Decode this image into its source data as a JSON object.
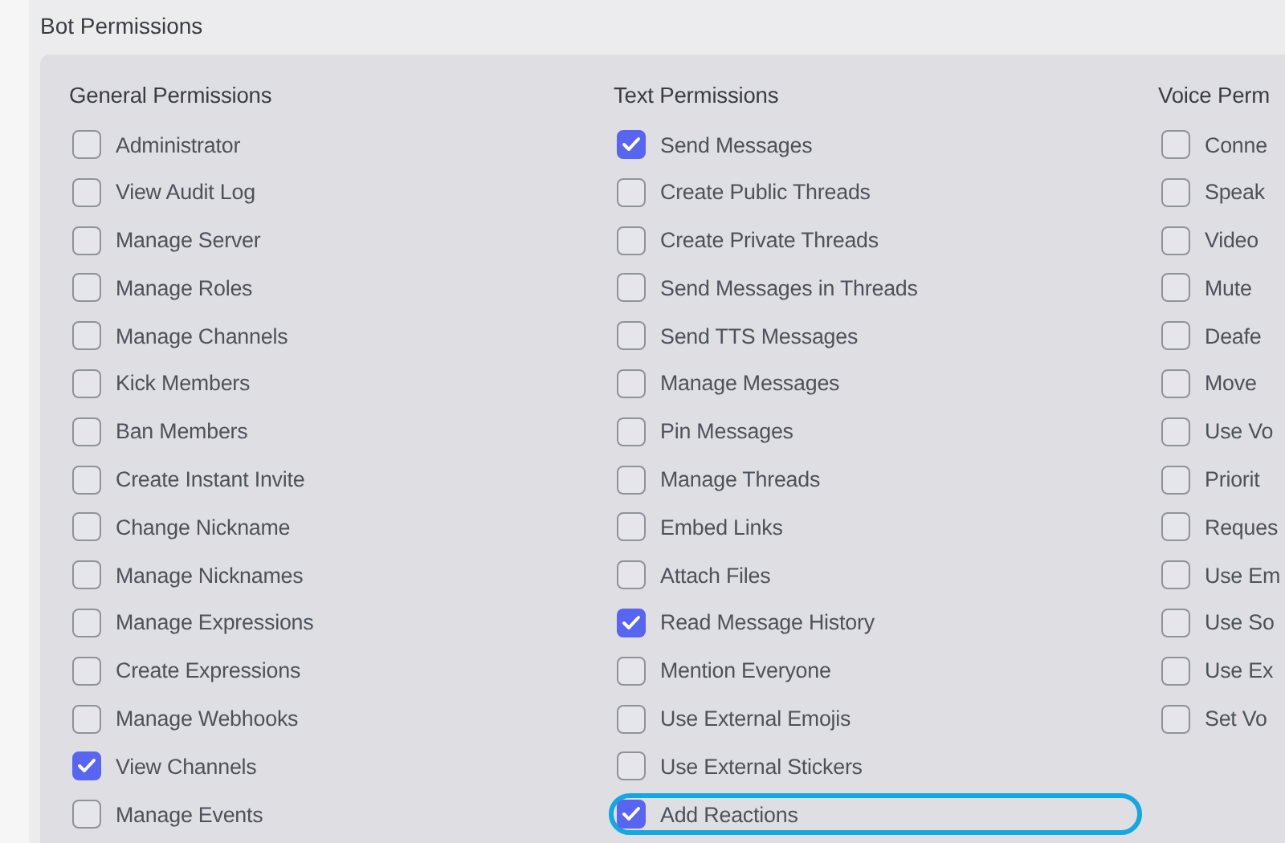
{
  "title": "Bot Permissions",
  "groups": [
    {
      "heading": "General Permissions",
      "items": [
        {
          "label": "Administrator",
          "checked": false,
          "highlighted": false
        },
        {
          "label": "View Audit Log",
          "checked": false,
          "highlighted": false
        },
        {
          "label": "Manage Server",
          "checked": false,
          "highlighted": false
        },
        {
          "label": "Manage Roles",
          "checked": false,
          "highlighted": false
        },
        {
          "label": "Manage Channels",
          "checked": false,
          "highlighted": false
        },
        {
          "label": "Kick Members",
          "checked": false,
          "highlighted": false
        },
        {
          "label": "Ban Members",
          "checked": false,
          "highlighted": false
        },
        {
          "label": "Create Instant Invite",
          "checked": false,
          "highlighted": false
        },
        {
          "label": "Change Nickname",
          "checked": false,
          "highlighted": false
        },
        {
          "label": "Manage Nicknames",
          "checked": false,
          "highlighted": false
        },
        {
          "label": "Manage Expressions",
          "checked": false,
          "highlighted": false
        },
        {
          "label": "Create Expressions",
          "checked": false,
          "highlighted": false
        },
        {
          "label": "Manage Webhooks",
          "checked": false,
          "highlighted": false
        },
        {
          "label": "View Channels",
          "checked": true,
          "highlighted": false
        },
        {
          "label": "Manage Events",
          "checked": false,
          "highlighted": false
        }
      ]
    },
    {
      "heading": "Text Permissions",
      "items": [
        {
          "label": "Send Messages",
          "checked": true,
          "highlighted": false
        },
        {
          "label": "Create Public Threads",
          "checked": false,
          "highlighted": false
        },
        {
          "label": "Create Private Threads",
          "checked": false,
          "highlighted": false
        },
        {
          "label": "Send Messages in Threads",
          "checked": false,
          "highlighted": false
        },
        {
          "label": "Send TTS Messages",
          "checked": false,
          "highlighted": false
        },
        {
          "label": "Manage Messages",
          "checked": false,
          "highlighted": false
        },
        {
          "label": "Pin Messages",
          "checked": false,
          "highlighted": false
        },
        {
          "label": "Manage Threads",
          "checked": false,
          "highlighted": false
        },
        {
          "label": "Embed Links",
          "checked": false,
          "highlighted": false
        },
        {
          "label": "Attach Files",
          "checked": false,
          "highlighted": false
        },
        {
          "label": "Read Message History",
          "checked": true,
          "highlighted": false
        },
        {
          "label": "Mention Everyone",
          "checked": false,
          "highlighted": false
        },
        {
          "label": "Use External Emojis",
          "checked": false,
          "highlighted": false
        },
        {
          "label": "Use External Stickers",
          "checked": false,
          "highlighted": false
        },
        {
          "label": "Add Reactions",
          "checked": true,
          "highlighted": true
        }
      ]
    },
    {
      "heading": "Voice Perm",
      "items": [
        {
          "label": "Conne",
          "checked": false,
          "highlighted": false
        },
        {
          "label": "Speak",
          "checked": false,
          "highlighted": false
        },
        {
          "label": "Video",
          "checked": false,
          "highlighted": false
        },
        {
          "label": "Mute",
          "checked": false,
          "highlighted": false
        },
        {
          "label": "Deafe",
          "checked": false,
          "highlighted": false
        },
        {
          "label": "Move",
          "checked": false,
          "highlighted": false
        },
        {
          "label": "Use Vo",
          "checked": false,
          "highlighted": false
        },
        {
          "label": "Priorit",
          "checked": false,
          "highlighted": false
        },
        {
          "label": "Reques",
          "checked": false,
          "highlighted": false
        },
        {
          "label": "Use Em",
          "checked": false,
          "highlighted": false
        },
        {
          "label": "Use So",
          "checked": false,
          "highlighted": false
        },
        {
          "label": "Use Ex",
          "checked": false,
          "highlighted": false
        },
        {
          "label": "Set Vo",
          "checked": false,
          "highlighted": false
        }
      ]
    }
  ]
}
